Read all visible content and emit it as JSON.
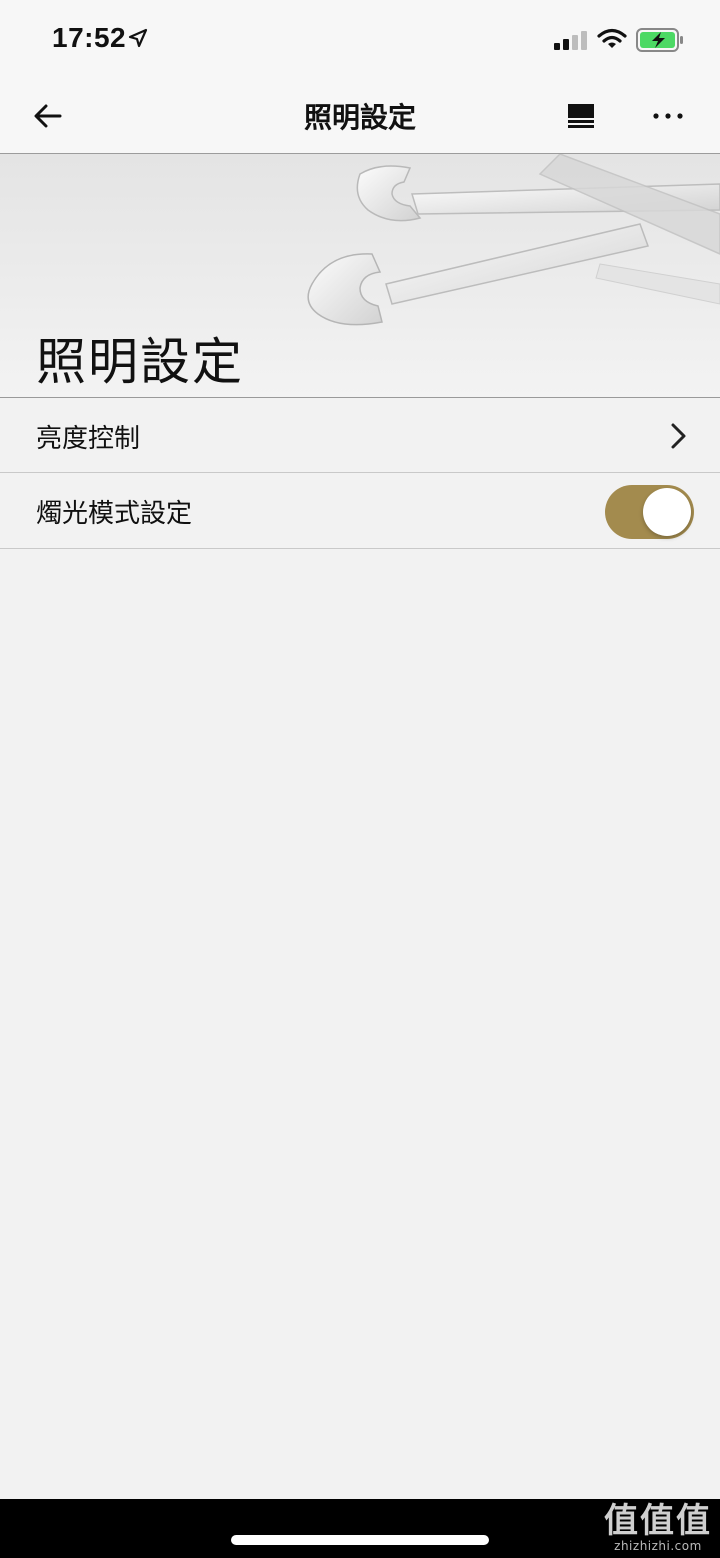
{
  "status_bar": {
    "time": "17:52",
    "icons": [
      "location-arrow-icon",
      "cellular-signal-icon",
      "wifi-icon",
      "battery-charging-icon"
    ]
  },
  "nav": {
    "title": "照明設定",
    "icons": [
      "back-arrow-icon",
      "list-view-icon",
      "more-icon"
    ]
  },
  "hero": {
    "title": "照明設定"
  },
  "settings": [
    {
      "label": "亮度控制",
      "control": "chevron-right-icon"
    },
    {
      "label": "燭光模式設定",
      "control": "toggle",
      "enabled": true
    }
  ],
  "colors": {
    "toggle_on": "#a38b4e",
    "battery_green": "#4cd964",
    "background": "#f2f2f2"
  },
  "watermark": {
    "mark": "值值值",
    "text": "zhizhizhi.com"
  }
}
